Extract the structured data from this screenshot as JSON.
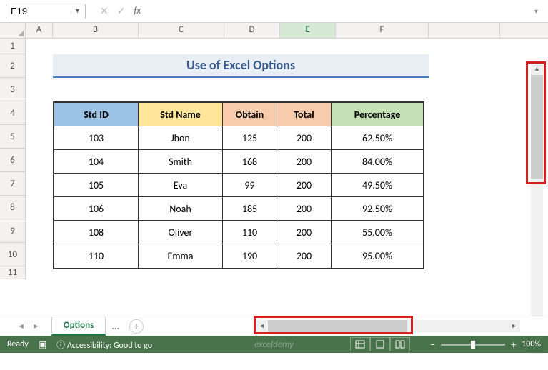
{
  "nameBox": {
    "value": "E19"
  },
  "formulaBar": {
    "fxLabel": "fx",
    "value": ""
  },
  "columns": [
    "A",
    "B",
    "C",
    "D",
    "E",
    "F"
  ],
  "activeColumn": "E",
  "rows": [
    "1",
    "2",
    "3",
    "4",
    "5",
    "6",
    "7",
    "8",
    "9",
    "10",
    "11"
  ],
  "title": "Use of Excel Options",
  "chart_data": {
    "type": "table",
    "title": "Use of Excel Options",
    "columns": [
      "Std ID",
      "Std Name",
      "Obtain",
      "Total",
      "Percentage"
    ],
    "rows": [
      [
        "103",
        "Jhon",
        "125",
        "200",
        "62.50%"
      ],
      [
        "104",
        "Smith",
        "168",
        "200",
        "84.00%"
      ],
      [
        "105",
        "Eva",
        "99",
        "200",
        "49.50%"
      ],
      [
        "106",
        "Noah",
        "185",
        "200",
        "92.50%"
      ],
      [
        "108",
        "Oliver",
        "110",
        "200",
        "55.00%"
      ],
      [
        "110",
        "Emma",
        "190",
        "200",
        "95.00%"
      ]
    ]
  },
  "tabs": {
    "activeSheet": "Options",
    "more": "...",
    "add": "+"
  },
  "statusBar": {
    "ready": "Ready",
    "accessibility": "Accessibility: Good to go",
    "zoom": "100%",
    "watermark": "exceldemy"
  }
}
